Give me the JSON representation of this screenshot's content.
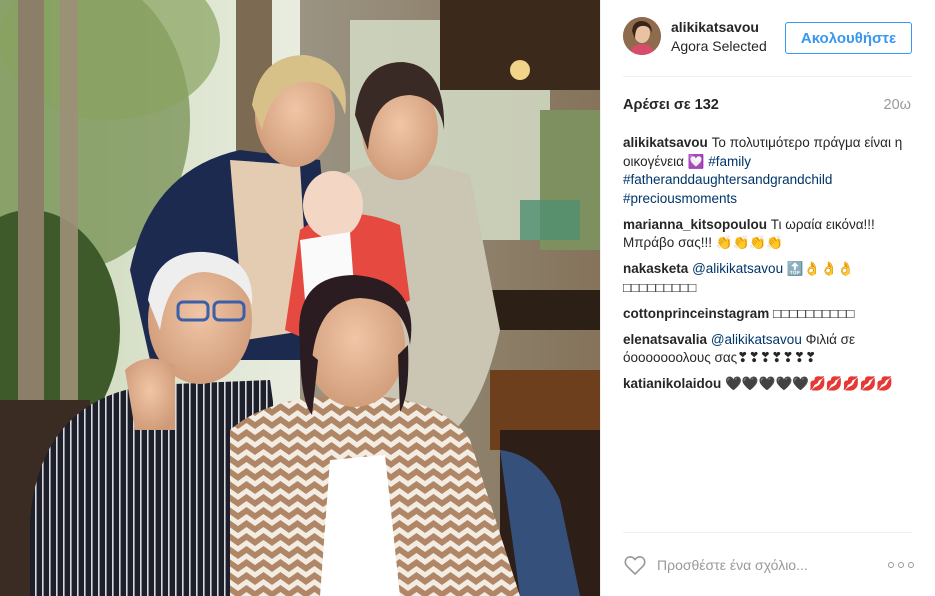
{
  "post": {
    "username": "alikikatsavou",
    "location": "Agora Selected",
    "follow_label": "Ακολουθήστε",
    "likes_text": "Αρέσει σε 132",
    "time_ago": "20ω",
    "caption": {
      "user": "alikikatsavou",
      "text": "Το πολυτιμότερο πράγμα είναι η οικογένεια 💟",
      "hashtags": [
        "#family",
        "#fatheranddaughtersandgrandchild",
        "#preciousmoments"
      ]
    },
    "comments": [
      {
        "user": "marianna_kitsopoulou",
        "mention": "",
        "text": "Τι ωραία εικόνα!!! Μπράβο σας!!! 👏👏👏👏"
      },
      {
        "user": "nakasketa",
        "mention": "@alikikatsavou",
        "text": "🔝👌👌👌□□□□□□□□□"
      },
      {
        "user": "cottonprinceinstagram",
        "mention": "",
        "text": "□□□□□□□□□□"
      },
      {
        "user": "elenatsavalia",
        "mention": "@alikikatsavou",
        "text": "Φιλιά σε όοοοοοοολους σας❣❣❣❣❣❣❣"
      },
      {
        "user": "katianikolaidou",
        "mention": "",
        "text": "🖤🖤🖤🖤🖤💋💋💋💋💋"
      }
    ],
    "add_comment_placeholder": "Προσθέστε ένα σχόλιο...",
    "icons": {
      "like": "heart-outline-icon",
      "more": "more-options-icon"
    }
  },
  "colors": {
    "accent": "#3897f0",
    "link": "#003569",
    "muted": "#999999",
    "text": "#262626",
    "divider": "#efefef"
  }
}
